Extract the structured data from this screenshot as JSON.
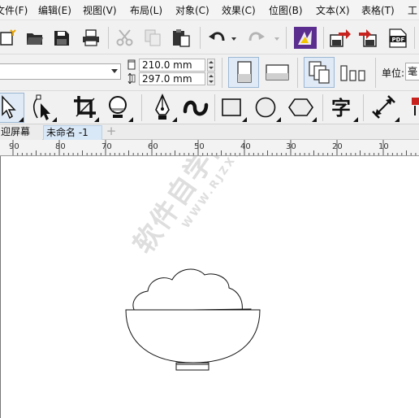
{
  "menu": {
    "items": [
      "文件(F)",
      "编辑(E)",
      "视图(V)",
      "布局(L)",
      "对象(C)",
      "效果(C)",
      "位图(B)",
      "文本(X)",
      "表格(T)",
      "工"
    ]
  },
  "property_bar": {
    "page_size_value": "",
    "width_value": "210.0 mm",
    "height_value": "297.0 mm",
    "unit_label": "单位:",
    "unit_value": "毫"
  },
  "tabs": {
    "welcome_label": "迎屏幕",
    "document_label": "未命名 -1",
    "add_label": "+"
  },
  "ruler": {
    "ticks": [
      "90",
      "80",
      "70",
      "60",
      "50",
      "40",
      "30",
      "20",
      "10"
    ]
  },
  "watermark": {
    "main_text": "软件自学网",
    "sub_text": "WWW.RJZXW.COM"
  },
  "colors": {
    "accent_purple": "#5b2d8e",
    "arrow_red": "#c8221e",
    "tab_active": "#d9e8f7"
  },
  "icons": {
    "toolbar": [
      "new-icon",
      "open-icon",
      "save-icon",
      "print-icon",
      "cut-icon",
      "copy-icon",
      "paste-icon",
      "undo-icon",
      "redo-icon",
      "launch-icon",
      "import-icon",
      "export-icon",
      "pdf-icon"
    ],
    "tools": [
      "pick-tool-icon",
      "shape-tool-icon",
      "crop-tool-icon",
      "zoom-tool-icon",
      "pen-tool-icon",
      "artistic-media-icon",
      "rectangle-tool-icon",
      "ellipse-tool-icon",
      "polygon-tool-icon",
      "text-tool-icon",
      "dimension-tool-icon"
    ]
  }
}
